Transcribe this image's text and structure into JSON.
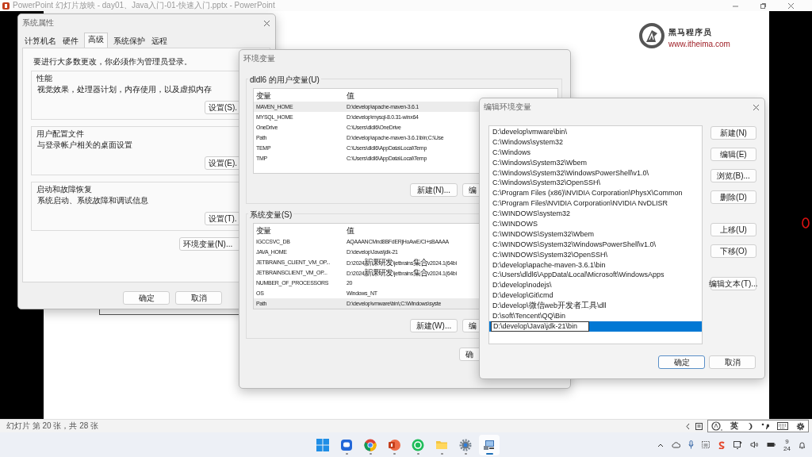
{
  "title_bar": {
    "title": "PowerPoint 幻灯片放映 - day01、Java入门-01-快速入门.pptx - PowerPoint"
  },
  "slide": {
    "logo": {
      "name": "黑马程序员",
      "url": "www.itheima.com"
    }
  },
  "system_properties": {
    "title": "系统属性",
    "tabs": [
      {
        "label": "计算机名",
        "selected": false
      },
      {
        "label": "硬件",
        "selected": false
      },
      {
        "label": "高级",
        "selected": true
      },
      {
        "label": "系统保护",
        "selected": false
      },
      {
        "label": "远程",
        "selected": false
      }
    ],
    "notice": "要进行大多数更改，你必须作为管理员登录。",
    "groups": [
      {
        "title": "性能",
        "description": "视觉效果，处理器计划，内存使用，以及虚拟内存",
        "button": "设置(S)."
      },
      {
        "title": "用户配置文件",
        "description": "与登录帐户相关的桌面设置",
        "button": "设置(E)."
      },
      {
        "title": "启动和故障恢复",
        "description": "系统启动、系统故障和调试信息",
        "button": "设置(T)."
      }
    ],
    "env_button": "环境变量(N)...",
    "buttons": [
      "确定",
      "取消"
    ]
  },
  "environment_variables": {
    "title": "环境变量",
    "sections": [
      {
        "title": "dldl6 的用户变量(U)",
        "columns": [
          "变量",
          "值"
        ],
        "rows": [
          {
            "name": "MAVEN_HOME",
            "value": "D:\\develop\\apache-maven-3.6.1",
            "selected": true
          },
          {
            "name": "MYSQL_HOME",
            "value": "D:\\develop\\mysql-8.0.31-winx64",
            "selected": false
          },
          {
            "name": "OneDrive",
            "value": "C:\\Users\\dldl6\\OneDrive",
            "selected": false
          },
          {
            "name": "Path",
            "value": "D:\\develop\\apache-maven-3.6.1\\bin;C:\\Use",
            "selected": false
          },
          {
            "name": "TEMP",
            "value": "C:\\Users\\dldl6\\AppData\\Local\\Temp",
            "selected": false
          },
          {
            "name": "TMP",
            "value": "C:\\Users\\dldl6\\AppData\\Local\\Temp",
            "selected": false
          }
        ],
        "buttons": [
          "新建(N)...",
          "编"
        ]
      },
      {
        "title": "系统变量(S)",
        "columns": [
          "变量",
          "值"
        ],
        "rows": [
          {
            "name": "IGCCSVC_DB",
            "value": "AQAAANCMnd8BFdERjHoAwE/Cl+sBAAAA",
            "selected": false
          },
          {
            "name": "JAVA_HOME",
            "value": "D:\\develop\\Java\\jdk-21",
            "selected": false
          },
          {
            "name": "JETBRAINS_CLIENT_VM_OP...",
            "value": "D:\\2024新课研发\\jetbrains集合v2024.1(64bi",
            "selected": false
          },
          {
            "name": "JETBRAINSCLIENT_VM_OP...",
            "value": "D:\\2024新课研发\\jetbrains集合v2024.1(64bi",
            "selected": false
          },
          {
            "name": "NUMBER_OF_PROCESSORS",
            "value": "20",
            "selected": false
          },
          {
            "name": "OS",
            "value": "Windows_NT",
            "selected": false
          },
          {
            "name": "Path",
            "value": "D:\\develop\\vmware\\bin\\;C:\\Windows\\syste",
            "selected": true
          }
        ],
        "buttons": [
          "新建(W)...",
          "编"
        ]
      }
    ],
    "buttons": [
      "确"
    ]
  },
  "edit_variable": {
    "title": "编辑环境变量",
    "entries": [
      {
        "value": "D:\\develop\\vmware\\bin\\",
        "selected": false
      },
      {
        "value": "C:\\Windows\\system32",
        "selected": false
      },
      {
        "value": "C:\\Windows",
        "selected": false
      },
      {
        "value": "C:\\Windows\\System32\\Wbem",
        "selected": false
      },
      {
        "value": "C:\\Windows\\System32\\WindowsPowerShell\\v1.0\\",
        "selected": false
      },
      {
        "value": "C:\\Windows\\System32\\OpenSSH\\",
        "selected": false
      },
      {
        "value": "C:\\Program Files (x86)\\NVIDIA Corporation\\PhysX\\Common",
        "selected": false
      },
      {
        "value": "C:\\Program Files\\NVIDIA Corporation\\NVIDIA NvDLISR",
        "selected": false
      },
      {
        "value": "C:\\WINDOWS\\system32",
        "selected": false
      },
      {
        "value": "C:\\WINDOWS",
        "selected": false
      },
      {
        "value": "C:\\WINDOWS\\System32\\Wbem",
        "selected": false
      },
      {
        "value": "C:\\WINDOWS\\System32\\WindowsPowerShell\\v1.0\\",
        "selected": false
      },
      {
        "value": "C:\\WINDOWS\\System32\\OpenSSH\\",
        "selected": false
      },
      {
        "value": "D:\\develop\\apache-maven-3.6.1\\bin",
        "selected": false
      },
      {
        "value": "C:\\Users\\dldl6\\AppData\\Local\\Microsoft\\WindowsApps",
        "selected": false
      },
      {
        "value": "D:\\develop\\nodejs\\",
        "selected": false
      },
      {
        "value": "D:\\develop\\Git\\cmd",
        "selected": false
      },
      {
        "value": "D:\\develop\\微信web开发者工具\\dll",
        "selected": false
      },
      {
        "value": "D:\\soft\\Tencent\\QQ\\Bin",
        "selected": false
      },
      {
        "value": "D:\\develop\\Java\\jdk-21\\bin",
        "selected": true
      }
    ],
    "side_buttons": [
      [
        "新建(N)",
        "编辑(E)",
        "浏览(B)...",
        "删除(D)"
      ],
      [
        "上移(U)",
        "下移(O)"
      ],
      [
        "编辑文本(T)..."
      ]
    ],
    "buttons": [
      {
        "label": "确定",
        "default": true
      },
      {
        "label": "取消",
        "default": false
      }
    ]
  },
  "status_bar": {
    "slide_info": "幻灯片 第 20 张，共 28 张",
    "ime_mode": "英"
  },
  "taskbar": {
    "apps": [
      {
        "kind": "start",
        "running": false,
        "selected": false
      },
      {
        "kind": "chat",
        "running": true,
        "selected": false
      },
      {
        "kind": "chrome",
        "running": true,
        "selected": false
      },
      {
        "kind": "powerpoint",
        "running": true,
        "selected": false
      },
      {
        "kind": "wechat",
        "running": true,
        "selected": false
      },
      {
        "kind": "folder",
        "running": true,
        "selected": false
      },
      {
        "kind": "settings",
        "running": true,
        "selected": false
      },
      {
        "kind": "remote",
        "running": true,
        "selected": true
      }
    ],
    "clock": {
      "time": "9",
      "date": "24"
    }
  }
}
